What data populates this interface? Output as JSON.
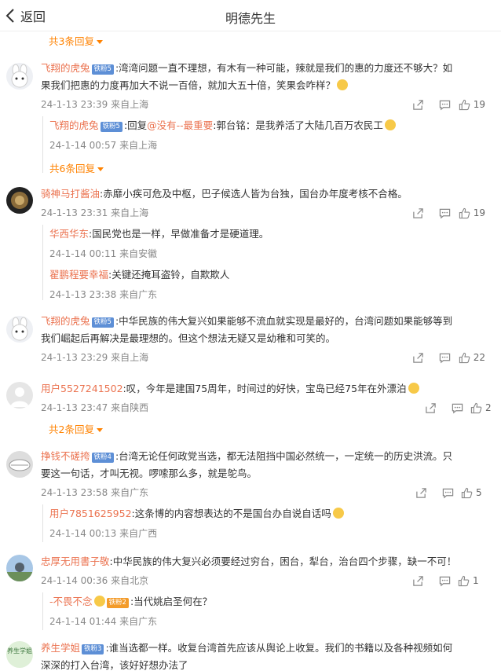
{
  "header": {
    "back_label": "返回",
    "title": "明德先生"
  },
  "colors": {
    "accent": "#ff8200",
    "username": "#eb7350",
    "badge_blue": "#5d8fd6",
    "badge_orange": "#f39b2a"
  },
  "top_more": "共3条回复",
  "comments": [
    {
      "user": "飞翔的虎兔",
      "badge": "铁粉5",
      "text_line1": ":湾湾问题一直不理想，有木有一种可能，辣就是我们的惠的力度还不够大？如",
      "text_line2": "果我们把惠的力度再加大不说一百倍，就加大五十倍，笑果会咋样？",
      "time": "24-1-13 23:39",
      "location": "来自上海",
      "likes": "19",
      "replies": [
        {
          "user": "飞翔的虎兔",
          "badge": "铁粉5",
          "prefix": ":回复",
          "mention": "@没有--最重要",
          "text": ":郭台铭：是我养活了大陆几百万农民工",
          "time": "24-1-14 00:57",
          "location": "来自上海"
        }
      ],
      "more": "共6条回复"
    },
    {
      "user": "骑神马打酱油",
      "badge": "",
      "text_line1": ":赤靡小疾可危及中枢，巴子候选人皆为台独，国台办年度考核不合格。",
      "text_line2": "",
      "time": "24-1-13 23:31",
      "location": "来自上海",
      "likes": "19",
      "replies": [
        {
          "user": "华西华东",
          "text": ":国民党也是一样，早做准备才是硬道理。",
          "time": "24-1-14 00:11",
          "location": "来自安徽"
        },
        {
          "user": "翟鹏程要幸福",
          "text": ":关键还掩耳盗铃，自欺欺人",
          "time": "24-1-13 23:38",
          "location": "来自广东"
        }
      ]
    },
    {
      "user": "飞翔的虎兔",
      "badge": "铁粉5",
      "text_line1": ":中华民族的伟大复兴如果能够不流血就实现是最好的，台湾问题如果能够等到",
      "text_line2": "我们崛起后再解决是最理想的。但这个想法无疑又是幼稚和可笑的。",
      "time": "24-1-13 23:29",
      "location": "来自上海",
      "likes": "22"
    },
    {
      "user": "用户5527241502",
      "badge": "",
      "text_line1": ":叹，今年是建国75周年，时间过的好快，宝岛已经75年在外漂泊",
      "text_line2": "",
      "time": "24-1-13 23:47",
      "location": "来自陕西",
      "likes": "2",
      "more": "共2条回复"
    },
    {
      "user": "挣钱不磋挎",
      "badge": "铁粉4",
      "text_line1": ":台湾无论任何政党当选，都无法阻挡中国必然统一，一定统一的历史洪流。只",
      "text_line2": "要这一句话，才叫无视。啰嗦那么多，就是鸵鸟。",
      "time": "24-1-13 23:58",
      "location": "来自广东",
      "likes": "5",
      "replies": [
        {
          "user": "用户7851625952",
          "text": ":这条博的内容想表达的不是国台办自说自话吗",
          "time": "24-1-14 00:13",
          "location": "来自广西"
        }
      ]
    },
    {
      "user": "忠厚无用書子敬",
      "badge": "",
      "text_line1": ":中华民族的伟大复兴必须要经过穷台，困台，犁台，治台四个步骤，缺一不可！",
      "text_line2": "",
      "time": "24-1-14 00:36",
      "location": "来自北京",
      "likes": "1",
      "replies": [
        {
          "user": "-不畏不念",
          "badge": "铁粉2",
          "text": ":当代姚启圣何在？",
          "time": "24-1-14 01:44",
          "location": "来自广东"
        }
      ]
    },
    {
      "user": "养生学姐",
      "badge": "铁粉3",
      "text_line1": ":谁当选都一样。收复台湾首先应该从舆论上收复。我们的书籍以及各种视频如何",
      "text_line2": "深深的打入台湾，该好好想办法了",
      "avatar_text": "养生学姐"
    }
  ]
}
